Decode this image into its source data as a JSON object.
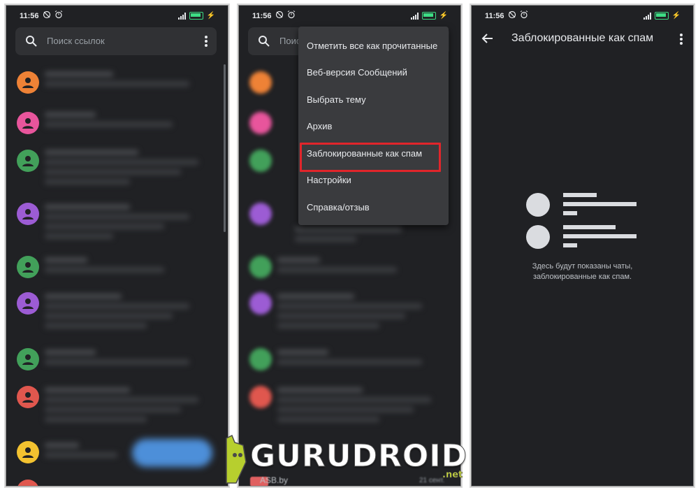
{
  "status": {
    "time": "11:56",
    "battery": "86"
  },
  "panel1": {
    "search_placeholder": "Поиск ссылок"
  },
  "panel2": {
    "search_placeholder": "Поис",
    "menu": [
      "Отметить все как прочитанные",
      "Веб-версия Сообщений",
      "Выбрать тему",
      "Архив",
      "Заблокированные как спам",
      "Настройки",
      "Справка/отзыв"
    ],
    "highlighted_item_index": 4,
    "highlight_color": "#e1252b",
    "bottom_row_label": "ASB.by",
    "bottom_row_time": "21 сент."
  },
  "panel3": {
    "title": "Заблокированные как спам",
    "empty_line1": "Здесь будут показаны чаты,",
    "empty_line2": "заблокированные как спам."
  },
  "avatar_colors": {
    "orange": "#ee8236",
    "pink": "#e8559c",
    "green": "#42a05a",
    "purple": "#9c5cd4",
    "red": "#e0574e",
    "yellow": "#f3c230"
  },
  "watermark": {
    "brand": "GURUDROID",
    "suffix": ".net"
  }
}
